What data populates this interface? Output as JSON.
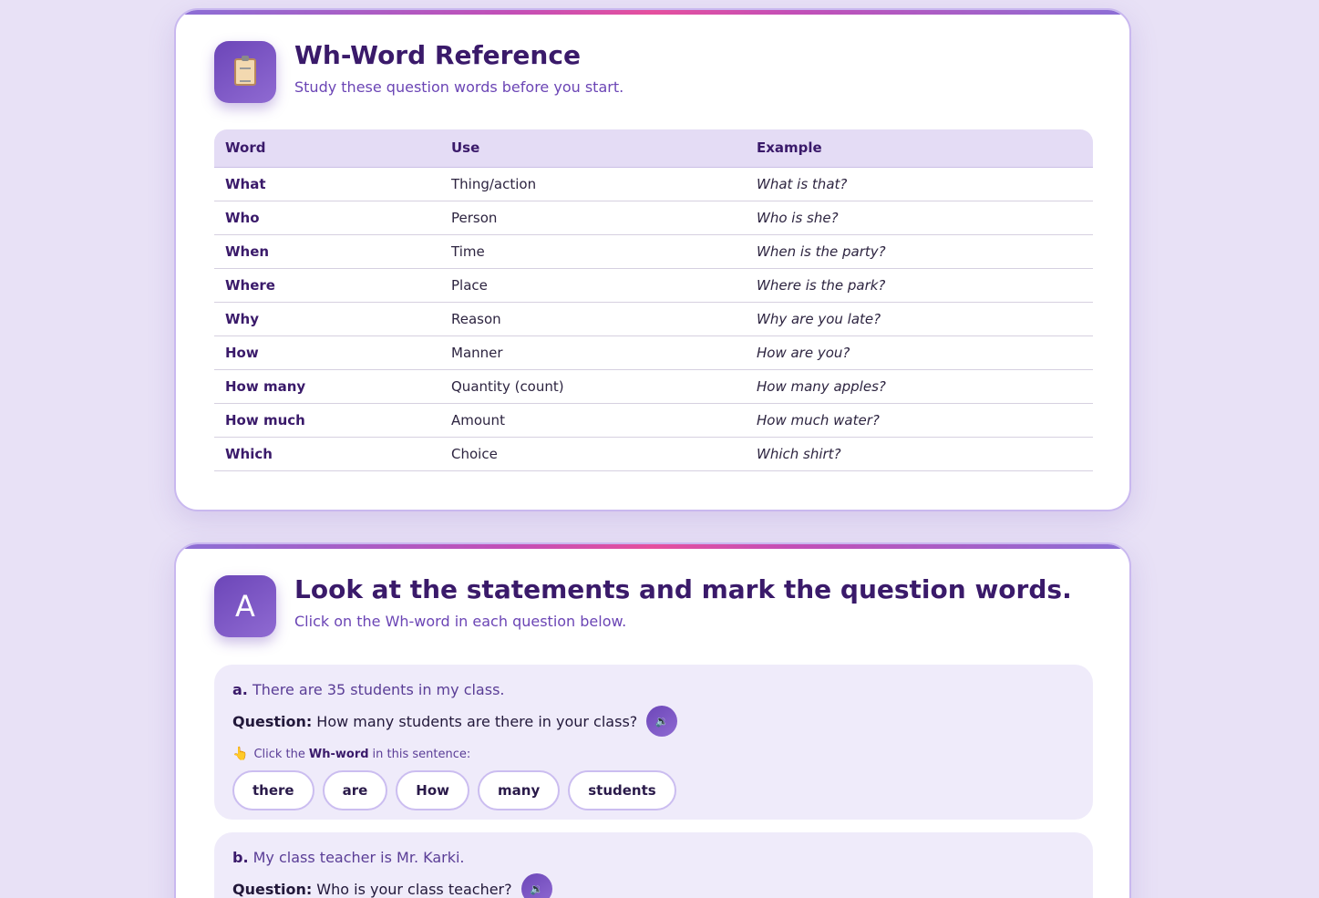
{
  "reference": {
    "icon": "clipboard-icon",
    "title": "Wh-Word Reference",
    "subtitle": "Study these question words before you start.",
    "columns": [
      "Word",
      "Use",
      "Example"
    ],
    "rows": [
      {
        "word": "What",
        "use": "Thing/action",
        "example": "What is that?"
      },
      {
        "word": "Who",
        "use": "Person",
        "example": "Who is she?"
      },
      {
        "word": "When",
        "use": "Time",
        "example": "When is the party?"
      },
      {
        "word": "Where",
        "use": "Place",
        "example": "Where is the park?"
      },
      {
        "word": "Why",
        "use": "Reason",
        "example": "Why are you late?"
      },
      {
        "word": "How",
        "use": "Manner",
        "example": "How are you?"
      },
      {
        "word": "How many",
        "use": "Quantity (count)",
        "example": "How many apples?"
      },
      {
        "word": "How much",
        "use": "Amount",
        "example": "How much water?"
      },
      {
        "word": "Which",
        "use": "Choice",
        "example": "Which shirt?"
      }
    ]
  },
  "section_a": {
    "badge": "A",
    "title": "Look at the statements and mark the question words.",
    "subtitle": "Click on the Wh-word in each question below.",
    "question_label": "Question:",
    "hint_prefix": "Click the",
    "hint_bold": "Wh-word",
    "hint_suffix": "in this sentence:",
    "items": [
      {
        "letter": "a.",
        "statement": "There are 35 students in my class.",
        "question": "How many students are there in your class?",
        "chips": [
          "there",
          "are",
          "How",
          "many",
          "students"
        ]
      },
      {
        "letter": "b.",
        "statement": "My class teacher is Mr. Karki.",
        "question": "Who is your class teacher?"
      }
    ]
  },
  "colors": {
    "accent": "#6c46b8",
    "background": "#e8e1f6",
    "strip_pink": "#e5509e"
  }
}
